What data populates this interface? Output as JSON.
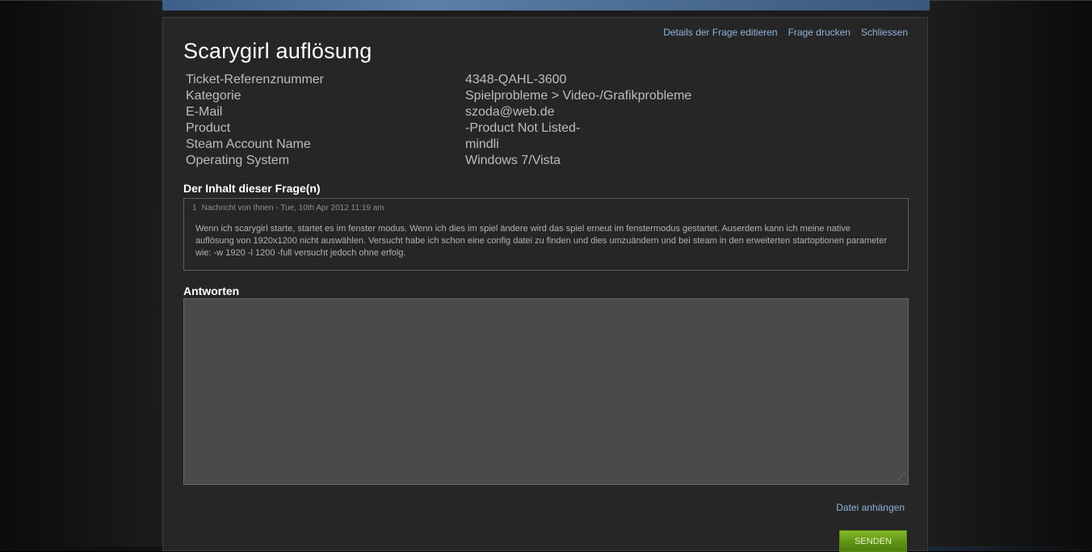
{
  "links": {
    "edit_details": "Details der Frage editieren",
    "print": "Frage drucken",
    "close": "Schliessen",
    "attach_file": "Datei anhängen"
  },
  "title": "Scarygirl auflösung",
  "ticket_info": [
    {
      "label": "Ticket-Referenznummer",
      "value": "4348-QAHL-3600"
    },
    {
      "label": "Kategorie",
      "value": "Spielprobleme > Video-/Grafikprobleme"
    },
    {
      "label": "E-Mail",
      "value": "szoda@web.de"
    },
    {
      "label": "Product",
      "value": "-Product Not Listed-"
    },
    {
      "label": "Steam Account Name",
      "value": "mindli"
    },
    {
      "label": "Operating System",
      "value": "Windows 7/Vista"
    }
  ],
  "content_section": {
    "heading": "Der Inhalt dieser Frage(n)",
    "messages": [
      {
        "number": "1",
        "meta": "Nachricht von Ihnen - Tue, 10th Apr 2012 11:19 am",
        "body": "Wenn ich scarygirl starte, startet es im fenster modus. Wenn ich dies im spiel ändere wird das spiel erneut im fenstermodus gestartet. Auserdem kann ich meine native auflösung von 1920x1200 nicht auswählen. Versucht habe ich schon eine config datei zu finden und dies umzuändern und bei steam in den erweiterten startoptionen parameter wie: -w 1920 -l 1200 -full versucht jedoch ohne erfolg."
      }
    ]
  },
  "reply_section": {
    "heading": "Antworten",
    "value": ""
  },
  "send_button": "SENDEN"
}
